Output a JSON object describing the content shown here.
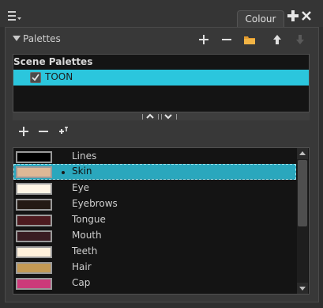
{
  "tab": {
    "title": "Colour"
  },
  "palettes_section": {
    "label": "Palettes"
  },
  "palette_list": {
    "header": "Scene Palettes",
    "items": [
      {
        "name": "TOON",
        "checked": true
      }
    ]
  },
  "colours": [
    {
      "name": "Lines",
      "color": "#000000",
      "selected": false
    },
    {
      "name": "Skin",
      "color": "#deb896",
      "selected": true
    },
    {
      "name": "Eye",
      "color": "#fff6e6",
      "selected": false
    },
    {
      "name": "Eyebrows",
      "color": "#241a14",
      "selected": false
    },
    {
      "name": "Tongue",
      "color": "#4d1a1f",
      "selected": false
    },
    {
      "name": "Mouth",
      "color": "#391c22",
      "selected": false
    },
    {
      "name": "Teeth",
      "color": "#fff1dc",
      "selected": false
    },
    {
      "name": "Hair",
      "color": "#c39a55",
      "selected": false
    },
    {
      "name": "Cap",
      "color": "#cc3a7a",
      "selected": false
    }
  ],
  "icons": {
    "menu": "menu-icon",
    "add": "plus-icon",
    "remove": "minus-icon",
    "folder": "folder-icon",
    "up": "arrow-up-icon",
    "down": "arrow-down-icon",
    "add_texture": "add-texture-icon"
  },
  "accent": "#2bc6dd"
}
